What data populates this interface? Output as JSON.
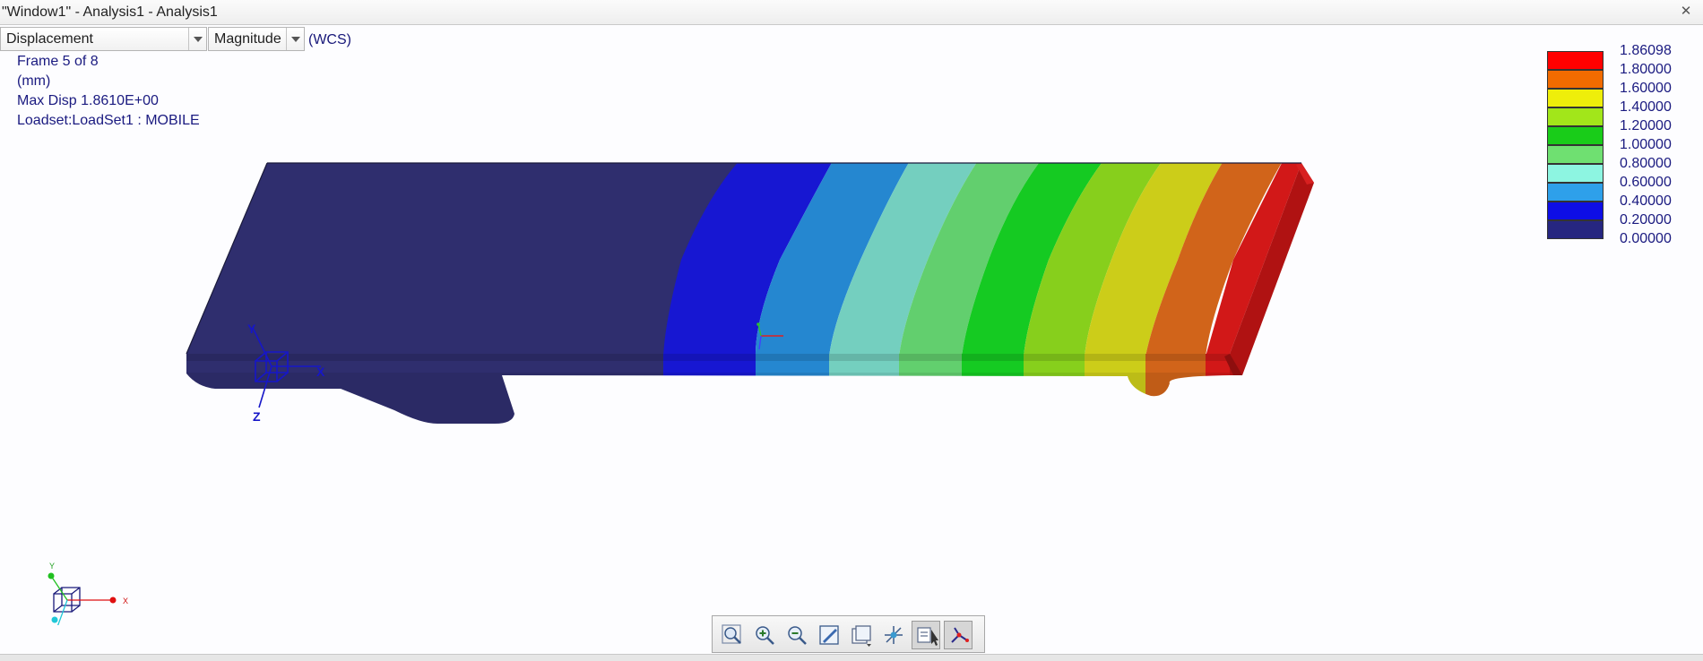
{
  "window": {
    "title": "\"Window1\" - Analysis1 - Analysis1",
    "close_icon": "close-icon"
  },
  "selectors": {
    "result_type": "Displacement",
    "component": "Magnitude",
    "csys": "(WCS)"
  },
  "info": {
    "frame": "Frame 5 of 8",
    "units": "(mm)",
    "max_disp": "Max Disp  1.8610E+00",
    "loadset": "Loadset:LoadSet1 :  MOBILE"
  },
  "legend": {
    "labels": [
      "1.86098",
      "1.80000",
      "1.60000",
      "1.40000",
      "1.20000",
      "1.00000",
      "0.80000",
      "0.60000",
      "0.40000",
      "0.20000",
      "0.00000"
    ],
    "colors": [
      "#ff0000",
      "#f26b00",
      "#eeee0a",
      "#a2e61a",
      "#19cc19",
      "#6fe071",
      "#8df5e1",
      "#2ea0ea",
      "#0e0ee6",
      "#262680"
    ]
  },
  "model": {
    "band_colors": [
      "#2f2e6e",
      "#1717d2",
      "#2587d0",
      "#74cfbf",
      "#62cf6e",
      "#15ca22",
      "#87cf1c",
      "#cccd19",
      "#d1641a",
      "#d21818"
    ],
    "csys_axes": [
      "X",
      "Y",
      "Z"
    ]
  },
  "tripod": {
    "axes": [
      "X",
      "Y"
    ],
    "colors": {
      "x": "#e01010",
      "y": "#20c020",
      "z": "#20c8d8"
    }
  },
  "toolbar": {
    "buttons": [
      {
        "name": "refit",
        "icon": "refit-icon"
      },
      {
        "name": "zoom-in",
        "icon": "zoom-in-icon"
      },
      {
        "name": "zoom-out",
        "icon": "zoom-out-icon"
      },
      {
        "name": "repaint",
        "icon": "repaint-icon"
      },
      {
        "name": "saved-orientations",
        "icon": "saved-views-icon"
      },
      {
        "name": "spin-center",
        "icon": "spin-center-icon"
      },
      {
        "name": "query",
        "icon": "query-icon"
      },
      {
        "name": "dynamic-query",
        "icon": "dynamic-query-icon"
      }
    ]
  }
}
